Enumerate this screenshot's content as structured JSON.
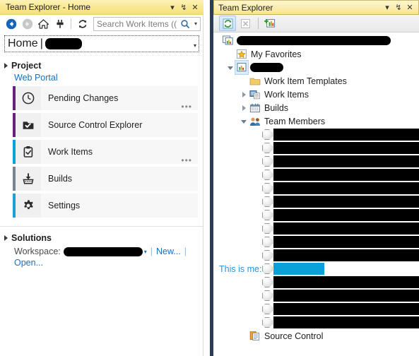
{
  "left_panel": {
    "title": "Team Explorer - Home",
    "window_buttons": [
      {
        "name": "dropdown-icon",
        "glyph": "▾"
      },
      {
        "name": "pin-icon",
        "glyph": "↯"
      },
      {
        "name": "close-icon",
        "glyph": "✕"
      }
    ],
    "toolbar": {
      "back_icon": "back-arrow-icon",
      "forward_icon": "forward-arrow-icon",
      "home_icon": "home-icon",
      "connect_icon": "plug-connect-icon",
      "refresh_icon": "refresh-icon"
    },
    "search": {
      "placeholder": "Search Work Items ((",
      "icon": "magnifier-icon",
      "dropdown_glyph": "▾"
    },
    "breadcrumb": {
      "home": "Home",
      "separator": "|",
      "project_redacted": true,
      "dropdown_glyph": "▾"
    },
    "project_section": {
      "heading": "Project",
      "web_portal_link": "Web Portal"
    },
    "nav_items": [
      {
        "label": "Pending Changes",
        "icon": "clock-icon",
        "accent": "#68217a",
        "overflow": "•••",
        "has_overflow": true
      },
      {
        "label": "Source Control Explorer",
        "icon": "source-control-folder-icon",
        "accent": "#68217a",
        "overflow": "",
        "has_overflow": false
      },
      {
        "label": "Work Items",
        "icon": "clipboard-check-icon",
        "accent": "#0aa1d9",
        "overflow": "•••",
        "has_overflow": true
      },
      {
        "label": "Builds",
        "icon": "builds-icon",
        "accent": "#7a8491",
        "overflow": "",
        "has_overflow": false
      },
      {
        "label": "Settings",
        "icon": "gear-icon",
        "accent": "#1e9fd8",
        "overflow": "",
        "has_overflow": false
      }
    ],
    "solutions_section": {
      "heading": "Solutions",
      "workspace_label": "Workspace:",
      "workspace_value_redacted": true,
      "workspace_dropdown_glyph": "▾",
      "new_link": "New...",
      "open_link": "Open...",
      "pipe": "|"
    }
  },
  "right_panel": {
    "title": "Team Explorer",
    "window_buttons": [
      {
        "name": "dropdown-icon",
        "glyph": "▾"
      },
      {
        "name": "pin-icon",
        "glyph": "↯"
      },
      {
        "name": "close-icon",
        "glyph": "✕"
      }
    ],
    "toolbar": {
      "refresh_icon": "refresh-icon",
      "delete_icon": "delete-x-icon",
      "add_server_icon": "add-team-project-icon"
    },
    "tree": {
      "server_node_redacted": true,
      "nodes": [
        {
          "label": "My Favorites",
          "icon": "favorites-star-icon",
          "indent": 1,
          "expander": "none"
        },
        {
          "label": "",
          "icon": "team-project-icon",
          "indent": 1,
          "expander": "open",
          "redacted": true,
          "selected": true
        },
        {
          "label": "Work Item Templates",
          "icon": "folder-icon",
          "indent": 2,
          "expander": "none"
        },
        {
          "label": "Work Items",
          "icon": "work-items-icon",
          "indent": 2,
          "expander": "closed"
        },
        {
          "label": "Builds",
          "icon": "builds-calendar-icon",
          "indent": 2,
          "expander": "closed"
        },
        {
          "label": "Team Members",
          "icon": "team-members-icon",
          "indent": 2,
          "expander": "open"
        }
      ],
      "members_before_me": 10,
      "members_after_me": 4,
      "me_annotation": "This is me:",
      "me_highlight_color": "#0aa1d9",
      "footer_node": {
        "label": "Source Control",
        "icon": "source-control-icon"
      }
    }
  }
}
